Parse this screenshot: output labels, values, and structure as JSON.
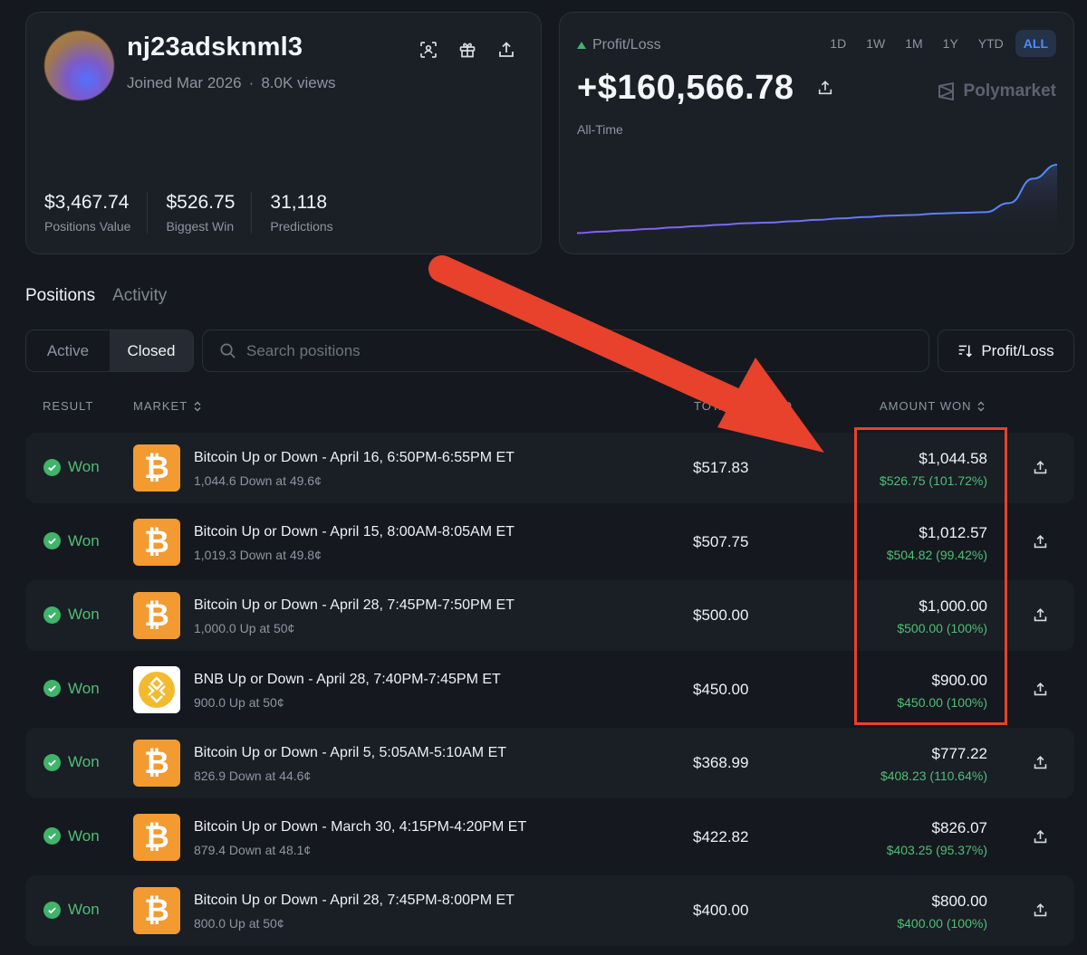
{
  "profile": {
    "username": "nj23adsknml3",
    "joined": "Joined Mar 2026",
    "views": "8.0K views",
    "stats": [
      {
        "value": "$3,467.74",
        "label": "Positions Value"
      },
      {
        "value": "$526.75",
        "label": "Biggest Win"
      },
      {
        "value": "31,118",
        "label": "Predictions"
      }
    ],
    "icons": [
      "scan-icon",
      "gift-icon",
      "share-icon"
    ]
  },
  "pnl": {
    "label": "Profit/Loss",
    "value": "+$160,566.78",
    "period": "All-Time",
    "brand": "Polymarket",
    "ranges": [
      "1D",
      "1W",
      "1M",
      "1Y",
      "YTD",
      "ALL"
    ],
    "active_range": "ALL",
    "trend": [
      0.02,
      0.04,
      0.06,
      0.08,
      0.1,
      0.12,
      0.14,
      0.16,
      0.17,
      0.19,
      0.21,
      0.23,
      0.25,
      0.27,
      0.28,
      0.3,
      0.31,
      0.32,
      0.45,
      0.8,
      1.0
    ]
  },
  "tabs": {
    "positions": "Positions",
    "activity": "Activity"
  },
  "filter": {
    "active": "Active",
    "closed": "Closed",
    "search_placeholder": "Search positions",
    "sort_label": "Profit/Loss"
  },
  "table": {
    "headers": {
      "result": "RESULT",
      "market": "MARKET",
      "traded": "TOTAL TRADED",
      "amount": "AMOUNT WON"
    },
    "rows": [
      {
        "result": "Won",
        "coin": "btc",
        "title": "Bitcoin Up or Down - April 16, 6:50PM-6:55PM ET",
        "sub": "1,044.6 Down at 49.6¢",
        "traded": "$517.83",
        "amount": "$1,044.58",
        "profit": "$526.75 (101.72%)"
      },
      {
        "result": "Won",
        "coin": "btc",
        "title": "Bitcoin Up or Down - April 15, 8:00AM-8:05AM ET",
        "sub": "1,019.3 Down at 49.8¢",
        "traded": "$507.75",
        "amount": "$1,012.57",
        "profit": "$504.82 (99.42%)"
      },
      {
        "result": "Won",
        "coin": "btc",
        "title": "Bitcoin Up or Down - April 28, 7:45PM-7:50PM ET",
        "sub": "1,000.0 Up at 50¢",
        "traded": "$500.00",
        "amount": "$1,000.00",
        "profit": "$500.00 (100%)"
      },
      {
        "result": "Won",
        "coin": "bnb",
        "title": "BNB Up or Down - April 28, 7:40PM-7:45PM ET",
        "sub": "900.0 Up at 50¢",
        "traded": "$450.00",
        "amount": "$900.00",
        "profit": "$450.00 (100%)"
      },
      {
        "result": "Won",
        "coin": "btc",
        "title": "Bitcoin Up or Down - April 5, 5:05AM-5:10AM ET",
        "sub": "826.9 Down at 44.6¢",
        "traded": "$368.99",
        "amount": "$777.22",
        "profit": "$408.23 (110.64%)"
      },
      {
        "result": "Won",
        "coin": "btc",
        "title": "Bitcoin Up or Down - March 30, 4:15PM-4:20PM ET",
        "sub": "879.4 Down at 48.1¢",
        "traded": "$422.82",
        "amount": "$826.07",
        "profit": "$403.25 (95.37%)"
      },
      {
        "result": "Won",
        "coin": "btc",
        "title": "Bitcoin Up or Down - April 28, 7:45PM-8:00PM ET",
        "sub": "800.0 Up at 50¢",
        "traded": "$400.00",
        "amount": "$800.00",
        "profit": "$400.00 (100%)"
      }
    ]
  },
  "colors": {
    "background": "#15191f",
    "card": "#1b1f26",
    "green": "#4fbf73",
    "accent_blue": "#4f8cf7",
    "bitcoin_orange": "#f39a31",
    "annotation_red": "#e8412c"
  }
}
